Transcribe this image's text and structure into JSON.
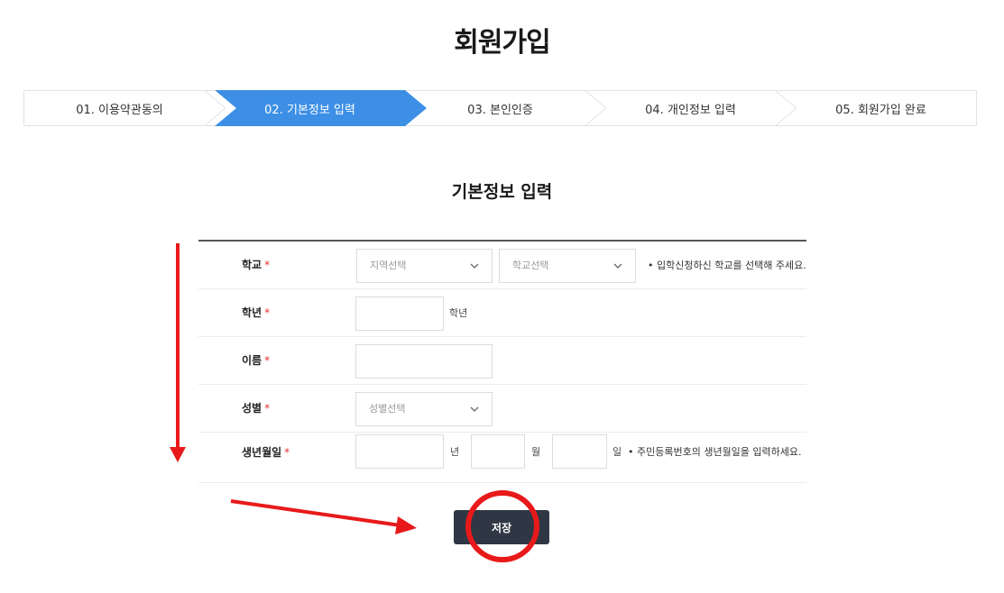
{
  "page": {
    "title": "회원가입"
  },
  "stepper": {
    "steps": [
      {
        "label": "01. 이용약관동의",
        "active": false
      },
      {
        "label": "02. 기본정보 입력",
        "active": true
      },
      {
        "label": "03. 본인인증",
        "active": false
      },
      {
        "label": "04. 개인정보 입력",
        "active": false
      },
      {
        "label": "05. 회원가입 완료",
        "active": false
      }
    ],
    "active_color": "#3d8fe6"
  },
  "section": {
    "title": "기본정보 입력"
  },
  "form": {
    "required_mark": "*",
    "school": {
      "label": "학교",
      "region_select": "지역선택",
      "school_select": "학교선택",
      "note": "• 입학신청하신 학교를 선택해 주세요."
    },
    "grade": {
      "label": "학년",
      "value": "",
      "unit": "학년"
    },
    "name": {
      "label": "이름",
      "value": ""
    },
    "gender": {
      "label": "성별",
      "select": "성별선택"
    },
    "birth": {
      "label": "생년월일",
      "year_unit": "년",
      "month_unit": "월",
      "day_unit": "일",
      "note": "• 주민등록번호의 생년월일을 입력하세요."
    }
  },
  "actions": {
    "save_label": "저장",
    "save_color": "#2f3744"
  },
  "annotations": {
    "color": "#e8191a"
  }
}
